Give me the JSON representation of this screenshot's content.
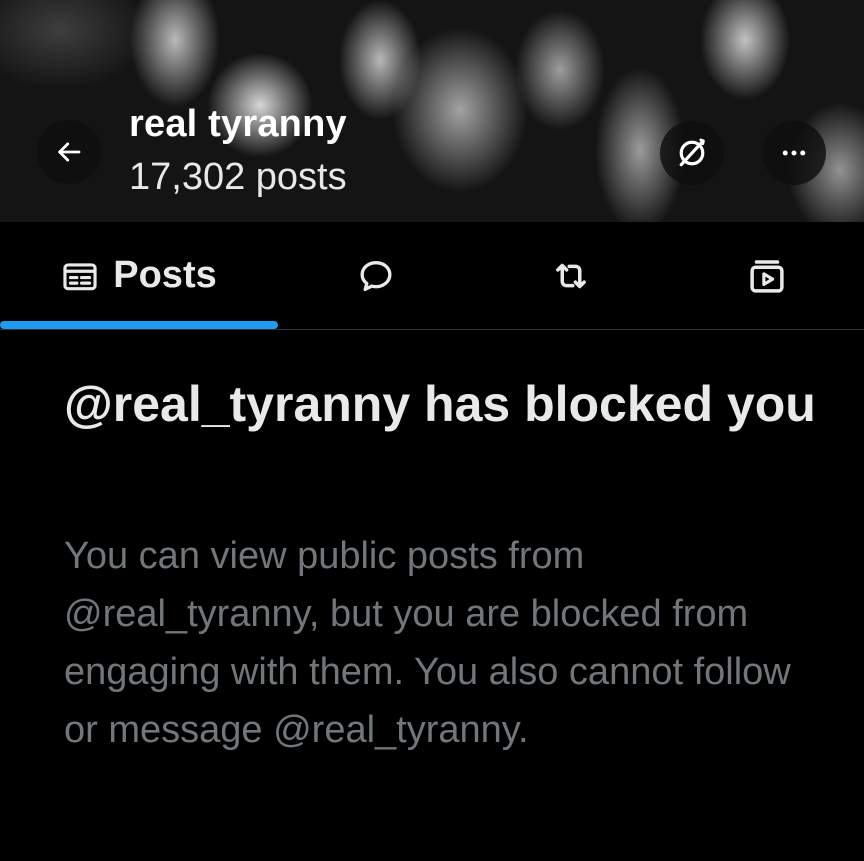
{
  "header": {
    "name": "real tyranny",
    "posts_count": "17,302 posts",
    "back_icon": "arrow-left-icon",
    "sync_icon": "sync-off-icon",
    "more_icon": "more-horizontal-icon"
  },
  "tabs": [
    {
      "label": "Posts",
      "icon": "posts-icon",
      "selected": true
    },
    {
      "label": "",
      "icon": "replies-icon",
      "selected": false
    },
    {
      "label": "",
      "icon": "reposts-icon",
      "selected": false
    },
    {
      "label": "",
      "icon": "media-icon",
      "selected": false
    }
  ],
  "blocked": {
    "title": "@real_tyranny has blocked you",
    "body": "You can view public posts from @real_tyranny, but you are blocked from engaging with them. You also cannot follow or message @real_tyranny."
  },
  "colors": {
    "accent": "#1d9bf0",
    "text_primary": "#e7e9ea",
    "text_secondary": "#71767b",
    "background": "#000000"
  }
}
